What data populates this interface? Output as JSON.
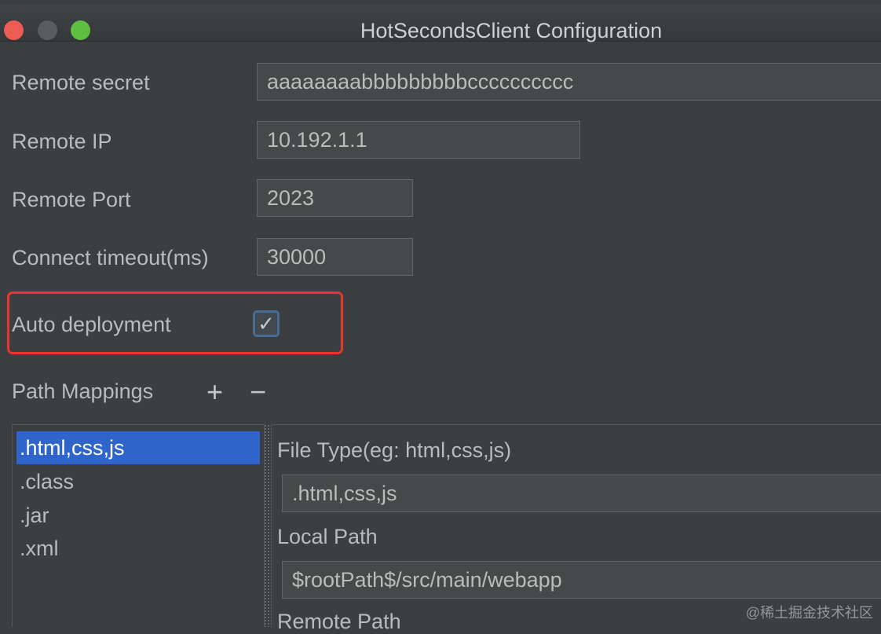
{
  "window": {
    "title": "HotSecondsClient Configuration"
  },
  "form": {
    "remote_secret_label": "Remote secret",
    "remote_secret_value": "aaaaaaaabbbbbbbbbcccccccccc",
    "remote_ip_label": "Remote IP",
    "remote_ip_value": "10.192.1.1",
    "remote_port_label": "Remote Port",
    "remote_port_value": "2023",
    "connect_timeout_label": "Connect timeout(ms)",
    "connect_timeout_value": "30000",
    "auto_deployment_label": "Auto deployment",
    "auto_deployment_checked": true,
    "checkmark_glyph": "✓"
  },
  "path_mappings": {
    "title": "Path Mappings",
    "add_symbol": "+",
    "remove_symbol": "−",
    "items": [
      {
        "label": ".html,css,js",
        "selected": true
      },
      {
        "label": ".class"
      },
      {
        "label": ".jar"
      },
      {
        "label": ".xml"
      }
    ],
    "detail": {
      "file_type_label": "File Type(eg: html,css,js)",
      "file_type_value": ".html,css,js",
      "local_path_label": "Local Path",
      "local_path_value": "$rootPath$/src/main/webapp",
      "remote_path_label": "Remote Path"
    }
  },
  "watermark": "@稀土掘金技术社区",
  "colors": {
    "background": "#3c3f41",
    "selection": "#2f65ca",
    "highlight_box": "#e8362c"
  }
}
